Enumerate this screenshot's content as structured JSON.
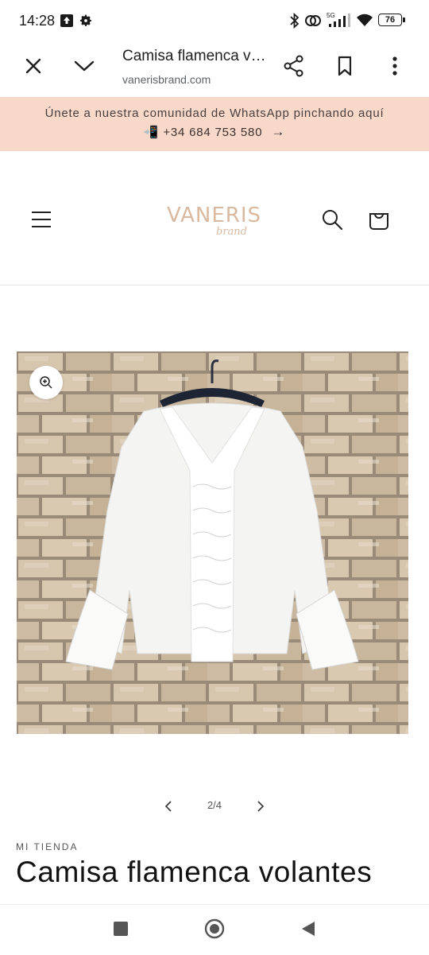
{
  "status_bar": {
    "time": "14:28",
    "battery": "76",
    "icons": [
      "upload-arrow-icon",
      "gear-icon",
      "bluetooth-icon",
      "nfc-icon",
      "signal-5g-icon",
      "wifi-icon",
      "battery-icon"
    ]
  },
  "browser": {
    "page_title": "Camisa flamenca volantes",
    "url": "vanerisbrand.com",
    "icons": [
      "close-icon",
      "chevron-down-icon",
      "share-icon",
      "bookmark-icon",
      "more-icon"
    ]
  },
  "announcement": {
    "line1": "Únete a nuestra comunidad de WhatsApp pinchando aquí",
    "phone_emoji": "📲",
    "phone": "+34 684 753 580",
    "arrow": "→",
    "background": "#f8d8c8"
  },
  "header": {
    "logo_main": "VANERIS",
    "logo_sub": "brand",
    "logo_color": "#d9b9a0",
    "icons": [
      "menu-icon",
      "search-icon",
      "cart-icon"
    ]
  },
  "gallery": {
    "current": 2,
    "total": 4,
    "counter": "2/4",
    "icons": [
      "zoom-icon",
      "chevron-left-icon",
      "chevron-right-icon"
    ]
  },
  "product": {
    "vendor": "MI TIENDA",
    "title": "Camisa flamenca volantes"
  },
  "nav_bar": {
    "icons": [
      "recents-square-icon",
      "home-circle-icon",
      "back-triangle-icon"
    ]
  }
}
